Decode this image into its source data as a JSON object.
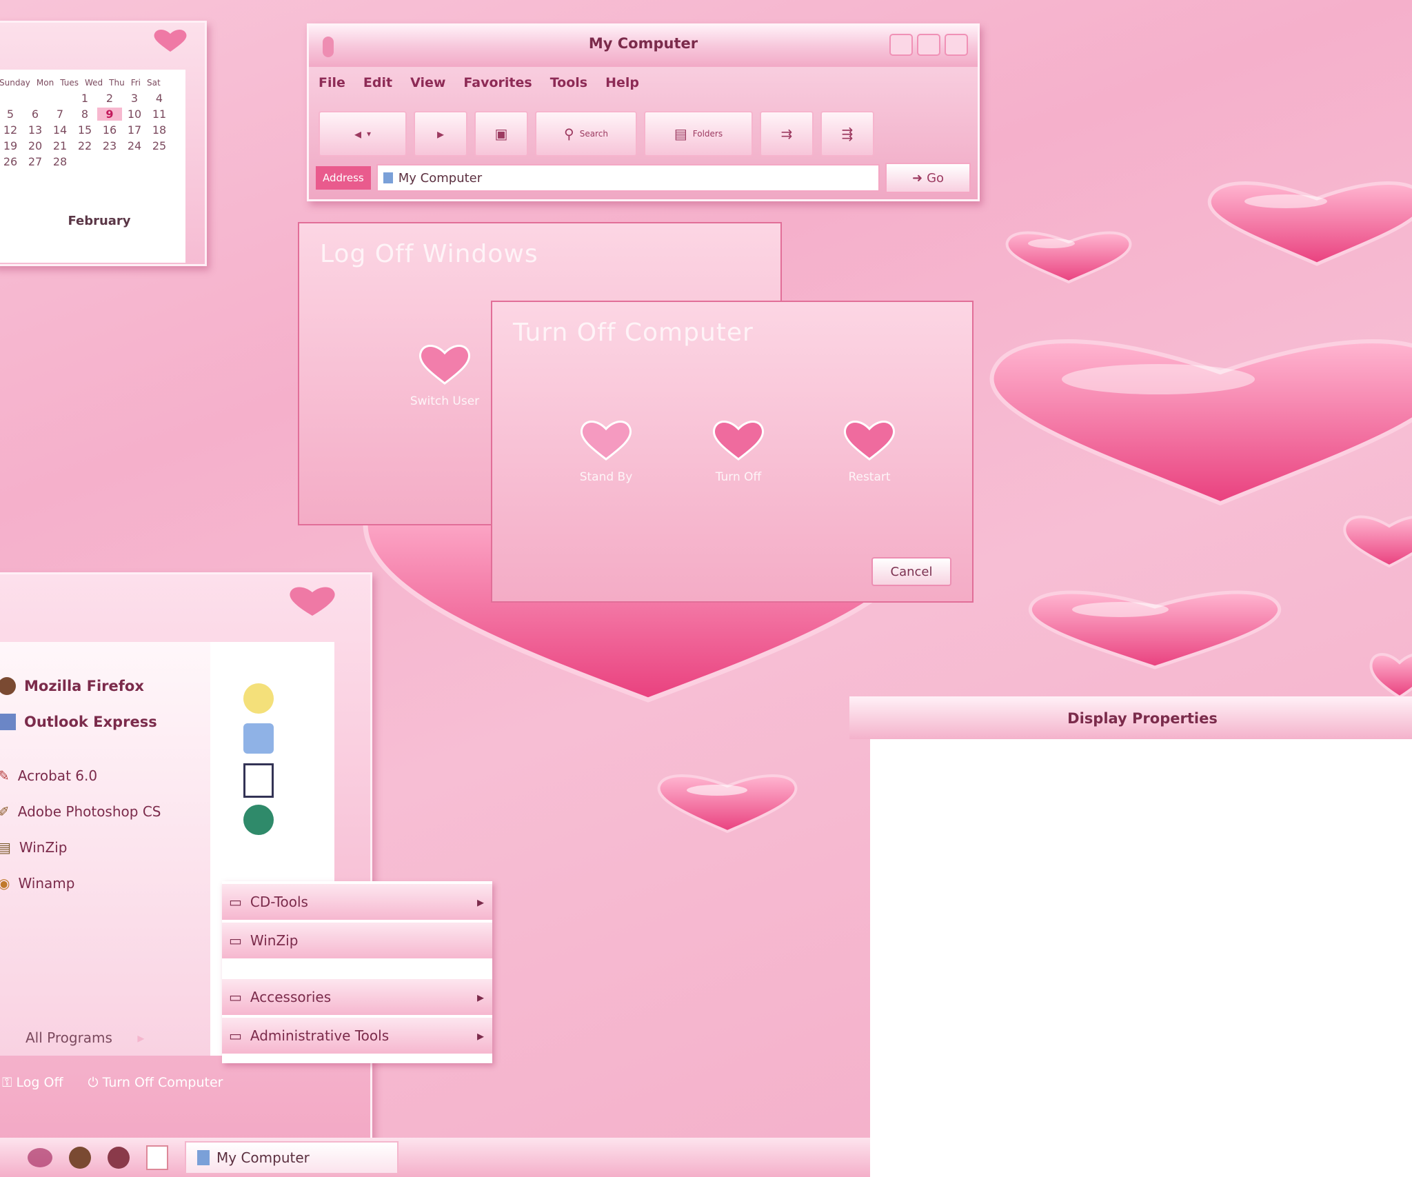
{
  "colors": {
    "accent": "#e95b8d",
    "desktop": "#f5b0cb",
    "heart": "#f06b9f"
  },
  "calendar": {
    "weekdays": [
      "Sunday",
      "Mon",
      "Tues",
      "Wed",
      "Thu",
      "Fri",
      "Sat"
    ],
    "weeks": [
      [
        "",
        "",
        "",
        "1",
        "2",
        "3",
        "4"
      ],
      [
        "5",
        "6",
        "7",
        "8",
        "9",
        "10",
        "11"
      ],
      [
        "12",
        "13",
        "14",
        "15",
        "16",
        "17",
        "18"
      ],
      [
        "19",
        "20",
        "21",
        "22",
        "23",
        "24",
        "25"
      ],
      [
        "26",
        "27",
        "28",
        "",
        "",
        "",
        ""
      ]
    ],
    "today": "9",
    "month": "February"
  },
  "explorer": {
    "title": "My Computer",
    "menu": [
      "File",
      "Edit",
      "View",
      "Favorites",
      "Tools",
      "Help"
    ],
    "toolbar": {
      "back": "Back",
      "search": "Search",
      "folders": "Folders"
    },
    "address_label": "Address",
    "address_value": "My Computer",
    "go_label": "Go"
  },
  "dialog_back": {
    "title": "Log Off Windows",
    "button": "Switch User"
  },
  "dialog_front": {
    "title": "Turn Off Computer",
    "buttons": [
      "Stand By",
      "Turn Off",
      "Restart"
    ],
    "cancel": "Cancel"
  },
  "startmenu": {
    "pinned": [
      "Mozilla Firefox",
      "Outlook Express"
    ],
    "recent": [
      "Acrobat 6.0",
      "Adobe Photoshop CS",
      "WinZip",
      "Winamp"
    ],
    "all_programs": "All Programs",
    "logoff": "Log Off",
    "turnoff": "Turn Off Computer"
  },
  "submenu": {
    "items": [
      {
        "label": "CD-Tools",
        "arrow": "▸"
      },
      {
        "label": "WinZip",
        "arrow": ""
      },
      {
        "label": "Accessories",
        "arrow": "▸"
      },
      {
        "label": "Administrative Tools",
        "arrow": "▸"
      }
    ]
  },
  "display_properties": {
    "title": "Display Properties"
  },
  "taskbar": {
    "task": "My Computer"
  }
}
